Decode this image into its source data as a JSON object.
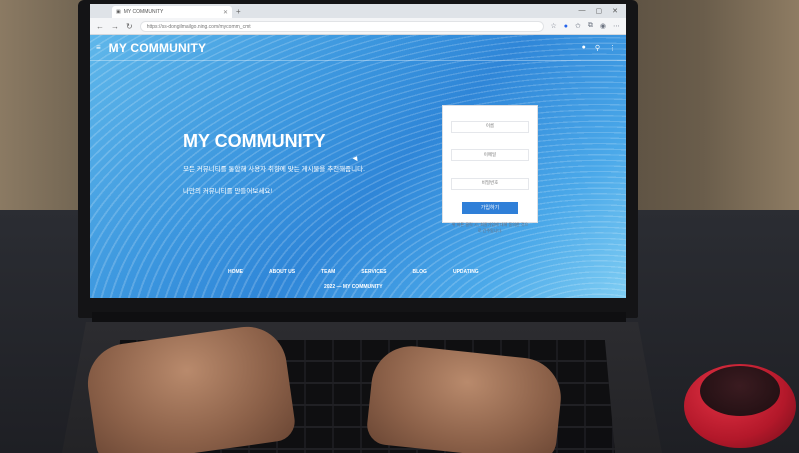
{
  "browser": {
    "tab_title": "MY COMMUNITY",
    "tab_close": "✕",
    "new_tab": "+",
    "window_controls": [
      "—",
      "▢",
      "✕"
    ],
    "url": "https://ss-dongilmailgo.ning.com/mycomm_cmt",
    "nav": {
      "back": "←",
      "forward": "→",
      "reload": "↻"
    },
    "toolbar_icons": [
      "star-icon",
      "extension-icon",
      "favorites-icon",
      "profile-icon",
      "more-icon"
    ]
  },
  "site": {
    "logo": "MY COMMUNITY",
    "header_icons": [
      "user-icon",
      "search-icon",
      "more-icon"
    ]
  },
  "hero": {
    "title": "MY COMMUNITY",
    "subtitle_1": "모든 커뮤니티를 통합해 사용자 취향에 맞는 게시물을 추천해줍니다.",
    "subtitle_2": "나만의 커뮤니티를 만들어보세요!"
  },
  "login": {
    "field_1_placeholder": "이름",
    "field_2_placeholder": "이메일",
    "field_3_placeholder": "비밀번호",
    "button_label": "가입하기",
    "note": "위 버튼 클릭 시, 회원가입에 대해 동의한 것으로 간주됩니다."
  },
  "footer": {
    "links": [
      "HOME",
      "ABOUT US",
      "TEAM",
      "SERVICES",
      "BLOG",
      "UPDATING"
    ],
    "copyright": "2022 — MY COMMUNITY"
  },
  "colors": {
    "accent": "#2f7fd8",
    "page_gradient_start": "#5fb7ea",
    "page_gradient_end": "#2f86d8"
  }
}
